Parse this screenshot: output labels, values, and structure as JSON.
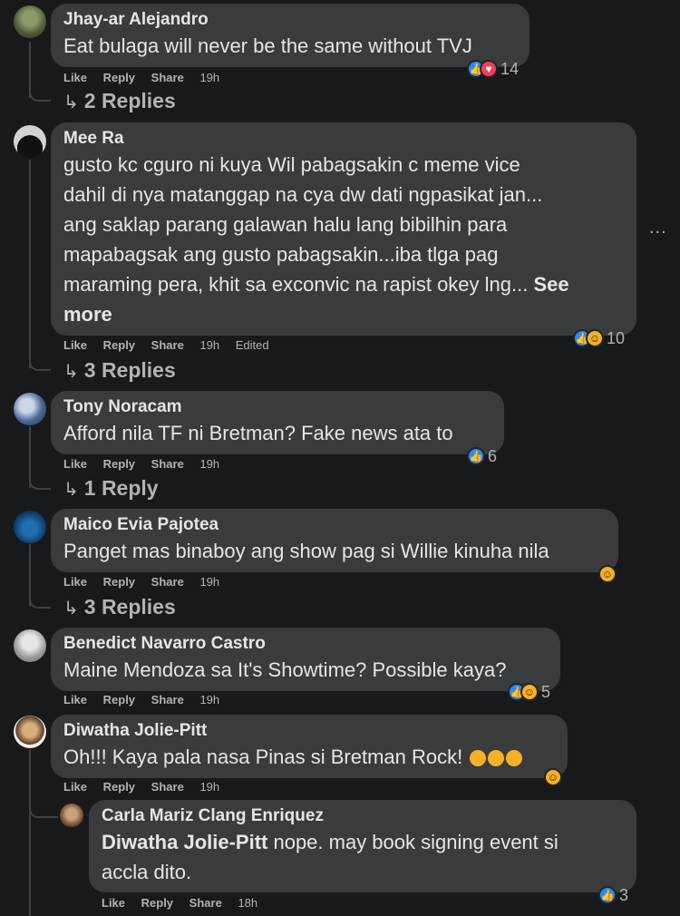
{
  "comments": [
    {
      "name": "Jhay-ar Alejandro",
      "text": "Eat bulaga will never be the same without TVJ",
      "actions": {
        "like": "Like",
        "reply": "Reply",
        "share": "Share",
        "time": "19h"
      },
      "reactions": "14",
      "replies": "2 Replies"
    },
    {
      "name": "Mee Ra",
      "text_lines": [
        "gusto kc cguro ni kuya Wil pabagsakin c meme vice",
        "dahil di nya matanggap na cya dw dati ngpasikat jan...",
        "ang saklap parang galawan halu lang bibilhin para",
        "mapabagsak ang gusto pabagsakin...iba tlga pag",
        "maraming pera, khit sa exconvic na rapist okey lng..."
      ],
      "see_more_1": "See",
      "see_more_2": "more",
      "actions": {
        "like": "Like",
        "reply": "Reply",
        "share": "Share",
        "time": "19h",
        "edited": "Edited"
      },
      "reactions": "10",
      "replies": "3 Replies",
      "more_options": "..."
    },
    {
      "name": "Tony Noracam",
      "text": "Afford nila TF ni Bretman? Fake news ata to",
      "actions": {
        "like": "Like",
        "reply": "Reply",
        "share": "Share",
        "time": "19h"
      },
      "reactions": "6",
      "replies": "1 Reply"
    },
    {
      "name": "Maico Evia Pajotea",
      "text": "Panget mas binaboy ang show pag si Willie kinuha nila",
      "actions": {
        "like": "Like",
        "reply": "Reply",
        "share": "Share",
        "time": "19h"
      },
      "replies": "3 Replies"
    },
    {
      "name": "Benedict Navarro Castro",
      "text": "Maine Mendoza sa It's Showtime? Possible kaya?",
      "actions": {
        "like": "Like",
        "reply": "Reply",
        "share": "Share",
        "time": "19h"
      },
      "reactions": "5"
    },
    {
      "name": "Diwatha Jolie-Pitt",
      "text": "Oh!!! Kaya pala nasa Pinas si Bretman Rock!",
      "actions": {
        "like": "Like",
        "reply": "Reply",
        "share": "Share",
        "time": "19h"
      },
      "reply": {
        "name": "Carla Mariz Clang Enriquez",
        "mention": "Diwatha Jolie-Pitt",
        "text_1": " nope. may book signing event si",
        "text_2": "accla dito.",
        "actions": {
          "like": "Like",
          "reply": "Reply",
          "share": "Share",
          "time": "18h"
        },
        "reactions": "3"
      }
    }
  ],
  "colors": {
    "background": "#18191a",
    "bubble": "#3a3b3c",
    "text": "#e4e6eb",
    "muted": "#b0b3b8",
    "like": "#2d88ff",
    "heart": "#f33e58",
    "haha": "#f7b125"
  },
  "icons": {
    "like": "like-icon",
    "love": "heart-icon",
    "haha": "haha-icon",
    "shocked": "shocked-emoji-icon",
    "reply_arrow": "reply-arrow-icon"
  }
}
